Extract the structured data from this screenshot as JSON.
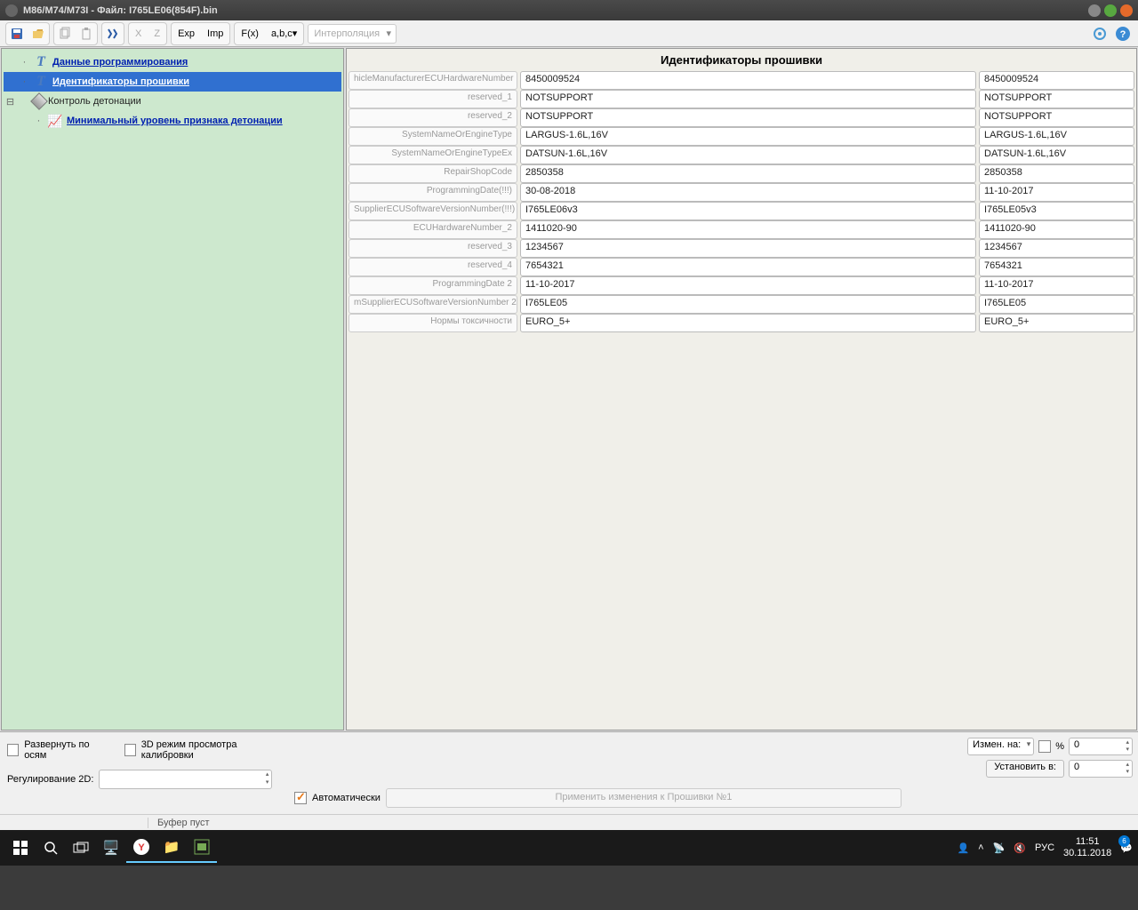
{
  "window": {
    "title": "M86/M74/M73I - Файл: I765LE06(854F).bin"
  },
  "toolbar": {
    "exp": "Exp",
    "imp": "Imp",
    "fx": "F(x)",
    "abc": "a,b,c",
    "interp": "Интерполяция",
    "x": "X",
    "z": "Z"
  },
  "tree": {
    "n0": "Данные программирования",
    "n1": "Идентификаторы прошивки",
    "n2": "Контроль детонации",
    "n3": "Минимальный уровень признака детонации"
  },
  "content": {
    "title": "Идентификаторы прошивки",
    "rows": [
      {
        "l": "hicleManufacturerECUHardwareNumber",
        "v1": "8450009524",
        "v2": "8450009524"
      },
      {
        "l": "reserved_1",
        "v1": "NOTSUPPORT",
        "v2": "NOTSUPPORT"
      },
      {
        "l": "reserved_2",
        "v1": "NOTSUPPORT",
        "v2": "NOTSUPPORT"
      },
      {
        "l": "SystemNameOrEngineType",
        "v1": "LARGUS-1.6L,16V",
        "v2": "LARGUS-1.6L,16V"
      },
      {
        "l": "SystemNameOrEngineTypeEx",
        "v1": "DATSUN-1.6L,16V",
        "v2": "DATSUN-1.6L,16V"
      },
      {
        "l": "RepairShopCode",
        "v1": "2850358",
        "v2": "2850358"
      },
      {
        "l": "ProgrammingDate(!!!)",
        "v1": "30-08-2018",
        "v2": "11-10-2017"
      },
      {
        "l": "SupplierECUSoftwareVersionNumber(!!!)",
        "v1": "I765LE06v3",
        "v2": "I765LE05v3"
      },
      {
        "l": "ECUHardwareNumber_2",
        "v1": "1411020-90",
        "v2": "1411020-90"
      },
      {
        "l": "reserved_3",
        "v1": "1234567",
        "v2": "1234567"
      },
      {
        "l": "reserved_4",
        "v1": "7654321",
        "v2": "7654321"
      },
      {
        "l": "ProgrammingDate 2",
        "v1": "11-10-2017",
        "v2": "11-10-2017"
      },
      {
        "l": "mSupplierECUSoftwareVersionNumber 2",
        "v1": "I765LE05",
        "v2": "I765LE05"
      },
      {
        "l": "Нормы токсичности",
        "v1": "EURO_5+",
        "v2": "EURO_5+"
      }
    ]
  },
  "bottom": {
    "expand": "Развернуть по осям",
    "view3d": "3D режим просмотра калибровки",
    "reg2d": "Регулирование 2D:",
    "auto": "Автоматически",
    "apply": "Применить изменения к Прошивки №1",
    "change": "Измен. на:",
    "pct": "%",
    "setto": "Установить в:",
    "v0": "0"
  },
  "status": {
    "buf": "Буфер пуст"
  },
  "taskbar": {
    "lang": "РУС",
    "time": "11:51",
    "date": "30.11.2018",
    "notif": "6"
  }
}
